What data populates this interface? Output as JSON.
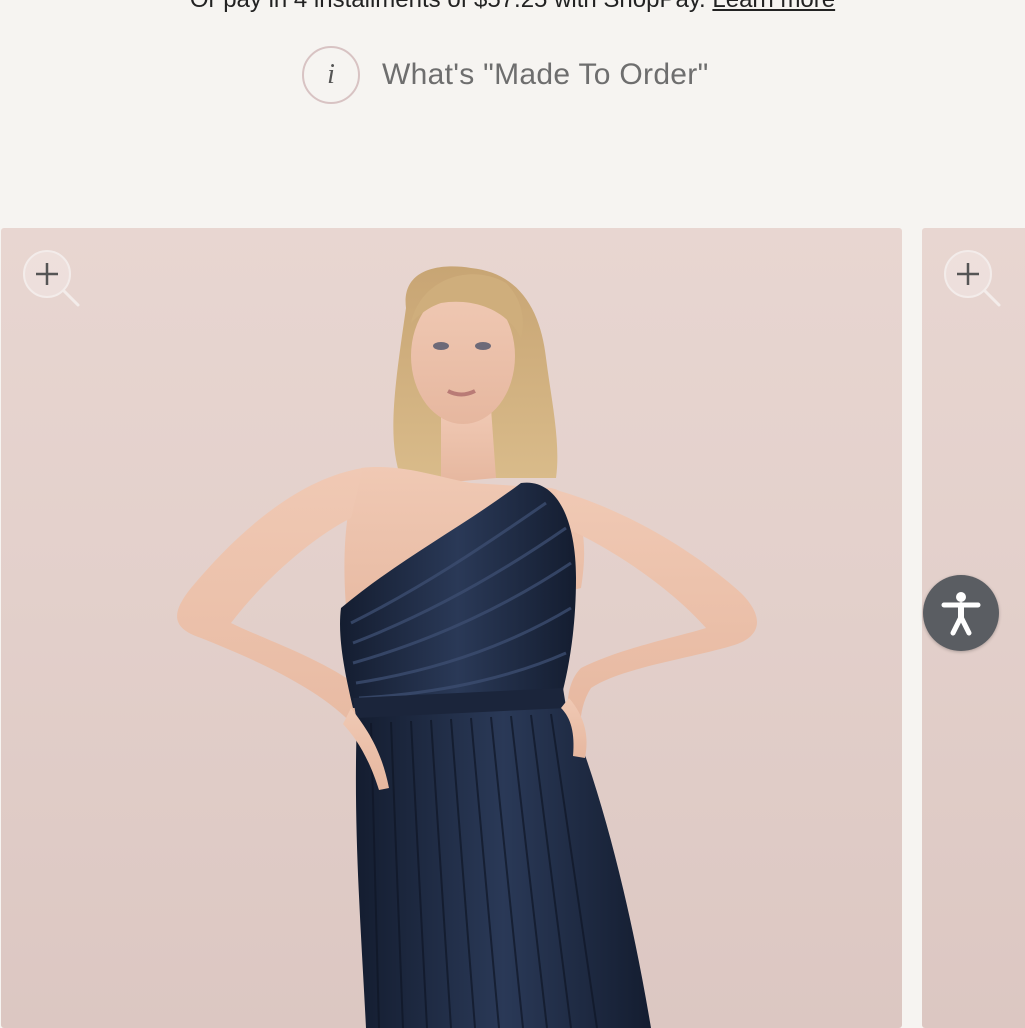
{
  "payment": {
    "text": "Or pay in 4 installments of $57.25 with ShopPay.",
    "link": "Learn more"
  },
  "made_to_order": {
    "icon": "info-icon",
    "icon_glyph": "i",
    "label": "What's \"Made To Order\""
  },
  "gallery": {
    "slides": [
      {
        "name": "product-image-1",
        "zoom_icon": "zoom-in-icon"
      },
      {
        "name": "product-image-2",
        "zoom_icon": "zoom-in-icon"
      }
    ]
  },
  "accessibility": {
    "icon": "accessibility-icon"
  },
  "colors": {
    "page_bg": "#f6f4f1",
    "photo_bg": "#e3d0cb",
    "dress": "#1e2a41",
    "a11y_button": "#5a5d62"
  }
}
